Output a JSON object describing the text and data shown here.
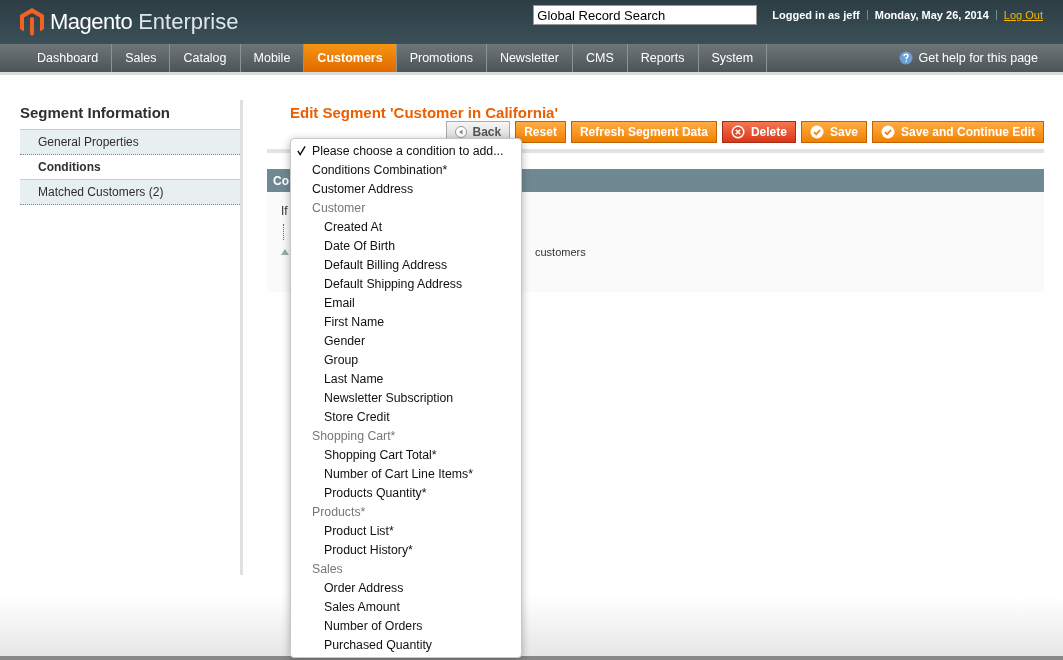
{
  "header": {
    "logo_brand": "Magento",
    "logo_product": "Enterprise",
    "search": {
      "value": "Global Record Search"
    },
    "user": "Logged in as jeff",
    "date": "Monday, May 26, 2014",
    "logout": "Log Out"
  },
  "nav": {
    "items": [
      {
        "label": "Dashboard",
        "selected": false
      },
      {
        "label": "Sales",
        "selected": false
      },
      {
        "label": "Catalog",
        "selected": false
      },
      {
        "label": "Mobile",
        "selected": false
      },
      {
        "label": "Customers",
        "selected": true
      },
      {
        "label": "Promotions",
        "selected": false
      },
      {
        "label": "Newsletter",
        "selected": false
      },
      {
        "label": "CMS",
        "selected": false
      },
      {
        "label": "Reports",
        "selected": false
      },
      {
        "label": "System",
        "selected": false
      }
    ],
    "help": "Get help for this page"
  },
  "sidebar": {
    "title": "Segment Information",
    "items": [
      {
        "label": "General Properties",
        "selected": false
      },
      {
        "label": "Conditions",
        "selected": true
      },
      {
        "label": "Matched Customers (2)",
        "selected": false
      }
    ]
  },
  "page": {
    "title": "Edit Segment 'Customer in California'",
    "buttons": [
      {
        "label": "Back",
        "kind": "back"
      },
      {
        "label": "Reset",
        "kind": "plain"
      },
      {
        "label": "Refresh Segment Data",
        "kind": "plain"
      },
      {
        "label": "Delete",
        "kind": "delete"
      },
      {
        "label": "Save",
        "kind": "save"
      },
      {
        "label": "Save and Continue Edit",
        "kind": "save"
      }
    ],
    "section": {
      "header": "Co",
      "rule_prefix": "If",
      "footnote_tail": "customers"
    }
  },
  "dropdown": {
    "items": [
      {
        "kind": "option",
        "label": "Please choose a condition to add...",
        "selected": true
      },
      {
        "kind": "option",
        "label": "Conditions Combination*",
        "selected": false
      },
      {
        "kind": "option",
        "label": "Customer Address",
        "selected": false
      },
      {
        "kind": "group",
        "label": "Customer",
        "children": [
          {
            "label": "Created At",
            "selected": false
          },
          {
            "label": "Date Of Birth",
            "selected": false
          },
          {
            "label": "Default Billing Address",
            "selected": false
          },
          {
            "label": "Default Shipping Address",
            "selected": false
          },
          {
            "label": "Email",
            "selected": false
          },
          {
            "label": "First Name",
            "selected": false
          },
          {
            "label": "Gender",
            "selected": false
          },
          {
            "label": "Group",
            "selected": false
          },
          {
            "label": "Last Name",
            "selected": false
          },
          {
            "label": "Newsletter Subscription",
            "selected": false
          },
          {
            "label": "Store Credit",
            "selected": false
          }
        ]
      },
      {
        "kind": "group",
        "label": "Shopping Cart*",
        "children": [
          {
            "label": "Shopping Cart Total*",
            "selected": false
          },
          {
            "label": "Number of Cart Line Items*",
            "selected": false
          },
          {
            "label": "Products Quantity*",
            "selected": false
          }
        ]
      },
      {
        "kind": "group",
        "label": "Products*",
        "children": [
          {
            "label": "Product List*",
            "selected": false
          },
          {
            "label": "Product History*",
            "selected": false
          }
        ]
      },
      {
        "kind": "group",
        "label": "Sales",
        "children": [
          {
            "label": "Order Address",
            "selected": false
          },
          {
            "label": "Sales Amount",
            "selected": false
          },
          {
            "label": "Number of Orders",
            "selected": false
          },
          {
            "label": "Purchased Quantity",
            "selected": false
          }
        ]
      }
    ]
  }
}
